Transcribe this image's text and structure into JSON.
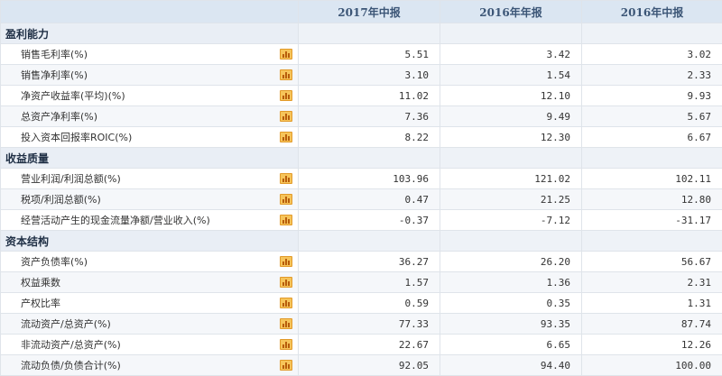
{
  "header": {
    "columns": [
      "2017年中报",
      "2016年年报",
      "2016年中报"
    ]
  },
  "sections": [
    {
      "title": "盈利能力",
      "rows": [
        {
          "label": "销售毛利率(%)",
          "values": [
            "5.51",
            "3.42",
            "3.02"
          ]
        },
        {
          "label": "销售净利率(%)",
          "values": [
            "3.10",
            "1.54",
            "2.33"
          ]
        },
        {
          "label": "净资产收益率(平均)(%)",
          "values": [
            "11.02",
            "12.10",
            "9.93"
          ]
        },
        {
          "label": "总资产净利率(%)",
          "values": [
            "7.36",
            "9.49",
            "5.67"
          ]
        },
        {
          "label": "投入资本回报率ROIC(%)",
          "values": [
            "8.22",
            "12.30",
            "6.67"
          ]
        }
      ]
    },
    {
      "title": "收益质量",
      "rows": [
        {
          "label": "营业利润/利润总额(%)",
          "values": [
            "103.96",
            "121.02",
            "102.11"
          ]
        },
        {
          "label": "税项/利润总额(%)",
          "values": [
            "0.47",
            "21.25",
            "12.80"
          ]
        },
        {
          "label": "经营活动产生的现金流量净额/营业收入(%)",
          "values": [
            "-0.37",
            "-7.12",
            "-31.17"
          ]
        }
      ]
    },
    {
      "title": "资本结构",
      "rows": [
        {
          "label": "资产负债率(%)",
          "values": [
            "36.27",
            "26.20",
            "56.67"
          ]
        },
        {
          "label": "权益乘数",
          "values": [
            "1.57",
            "1.36",
            "2.31"
          ]
        },
        {
          "label": "产权比率",
          "values": [
            "0.59",
            "0.35",
            "1.31"
          ]
        },
        {
          "label": "流动资产/总资产(%)",
          "values": [
            "77.33",
            "93.35",
            "87.74"
          ]
        },
        {
          "label": "非流动资产/总资产(%)",
          "values": [
            "22.67",
            "6.65",
            "12.26"
          ]
        },
        {
          "label": "流动负债/负债合计(%)",
          "values": [
            "92.05",
            "94.40",
            "100.00"
          ]
        }
      ]
    }
  ],
  "icons": {
    "row_chart": "bar-chart-icon"
  },
  "colors": {
    "header_bg": "#dbe6f2",
    "header_text": "#3b5576",
    "section_bg": "#e9eef5",
    "icon_fill": "#f6c45a"
  }
}
